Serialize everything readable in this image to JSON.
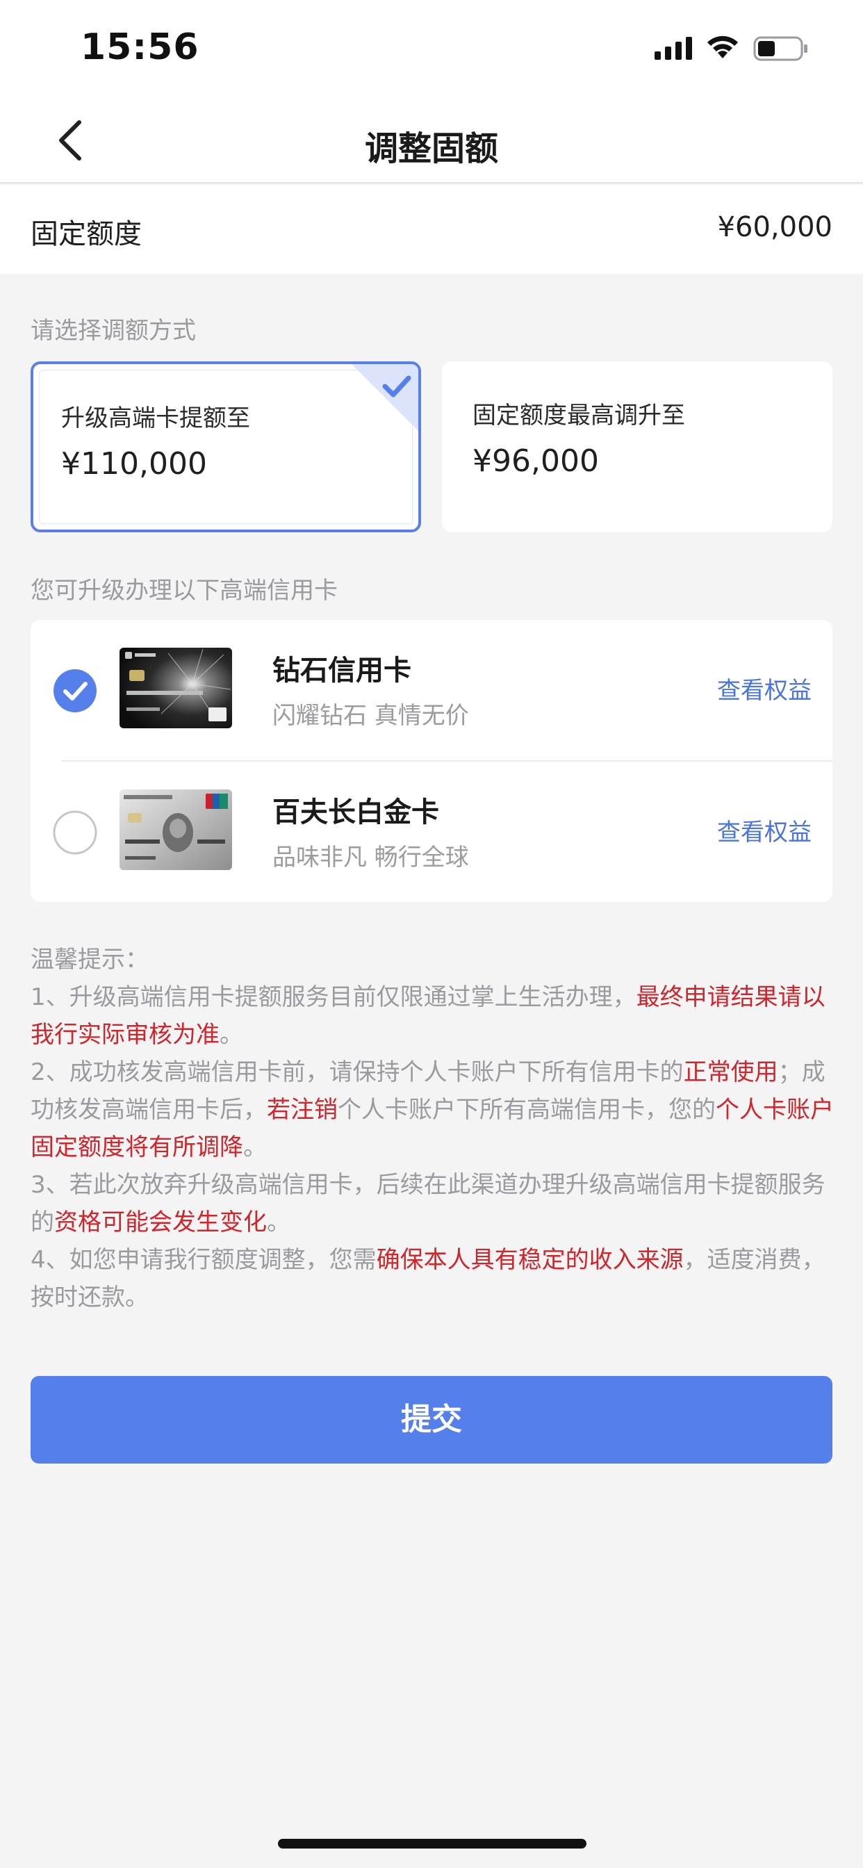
{
  "status_bar": {
    "time": "15:56",
    "icons": [
      "signal-icon",
      "wifi-icon",
      "battery-icon"
    ]
  },
  "nav": {
    "title": "调整固额",
    "back_icon": "back-chevron-icon"
  },
  "fixed_limit": {
    "label": "固定额度",
    "value": "¥60,000"
  },
  "method_section": {
    "label": "请选择调额方式",
    "options": [
      {
        "title": "升级高端卡提额至",
        "amount": "¥110,000",
        "selected": true
      },
      {
        "title": "固定额度最高调升至",
        "amount": "¥96,000",
        "selected": false
      }
    ]
  },
  "card_section": {
    "label": "您可升级办理以下高端信用卡",
    "cards": [
      {
        "name": "钻石信用卡",
        "slogan": "闪耀钻石 真情无价",
        "link": "查看权益",
        "selected": true,
        "icon": "diamond-card-image"
      },
      {
        "name": "百夫长白金卡",
        "slogan": "品味非凡 畅行全球",
        "link": "查看权益",
        "selected": false,
        "icon": "platinum-card-image"
      }
    ]
  },
  "tips": {
    "heading": "温馨提示：",
    "items": [
      [
        {
          "t": "1、升级高端信用卡提额服务目前仅限通过掌上生活办理，",
          "hl": false
        },
        {
          "t": "最终申请结果请以我行实际审核为准",
          "hl": true
        },
        {
          "t": "。",
          "hl": false
        }
      ],
      [
        {
          "t": "2、成功核发高端信用卡前，请保持个人卡账户下所有信用卡的",
          "hl": false
        },
        {
          "t": "正常使用",
          "hl": true
        },
        {
          "t": "；成功核发高端信用卡后，",
          "hl": false
        },
        {
          "t": "若注销",
          "hl": true
        },
        {
          "t": "个人卡账户下所有高端信用卡，您的",
          "hl": false
        },
        {
          "t": "个人卡账户固定额度将有所调降",
          "hl": true
        },
        {
          "t": "。",
          "hl": false
        }
      ],
      [
        {
          "t": "3、若此次放弃升级高端信用卡，后续在此渠道办理升级高端信用卡提额服务的",
          "hl": false
        },
        {
          "t": "资格可能会发生变化",
          "hl": true
        },
        {
          "t": "。",
          "hl": false
        }
      ],
      [
        {
          "t": "4、如您申请我行额度调整，您需",
          "hl": false
        },
        {
          "t": "确保本人具有稳定的收入来源",
          "hl": true
        },
        {
          "t": "，适度消费，按时还款。",
          "hl": false
        }
      ]
    ]
  },
  "submit": {
    "label": "提交"
  },
  "colors": {
    "accent": "#5580ec",
    "link": "#4a74e0",
    "highlight": "#d0252b",
    "background": "#f4f4f5"
  }
}
